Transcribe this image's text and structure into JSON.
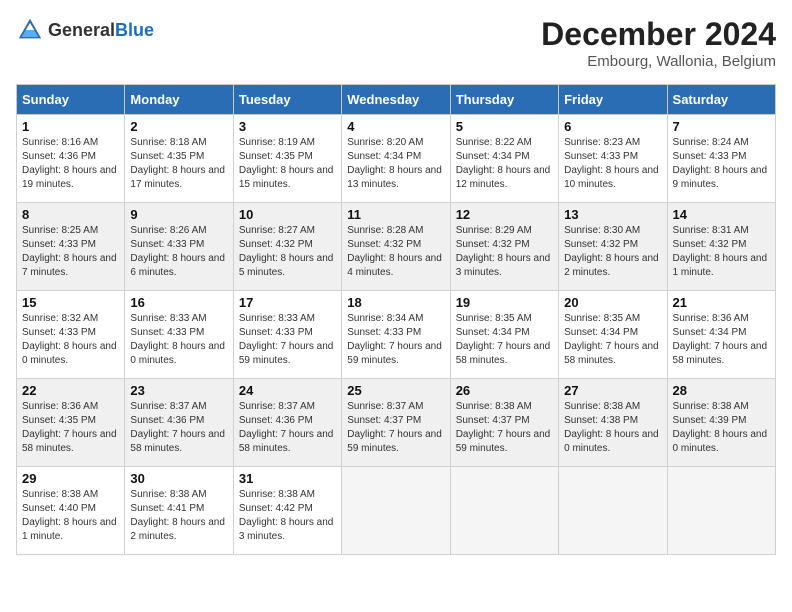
{
  "header": {
    "logo_general": "General",
    "logo_blue": "Blue",
    "month_year": "December 2024",
    "location": "Embourg, Wallonia, Belgium"
  },
  "days_of_week": [
    "Sunday",
    "Monday",
    "Tuesday",
    "Wednesday",
    "Thursday",
    "Friday",
    "Saturday"
  ],
  "weeks": [
    [
      {
        "day": "1",
        "sunrise": "8:16 AM",
        "sunset": "4:36 PM",
        "daylight": "8 hours and 19 minutes"
      },
      {
        "day": "2",
        "sunrise": "8:18 AM",
        "sunset": "4:35 PM",
        "daylight": "8 hours and 17 minutes"
      },
      {
        "day": "3",
        "sunrise": "8:19 AM",
        "sunset": "4:35 PM",
        "daylight": "8 hours and 15 minutes"
      },
      {
        "day": "4",
        "sunrise": "8:20 AM",
        "sunset": "4:34 PM",
        "daylight": "8 hours and 13 minutes"
      },
      {
        "day": "5",
        "sunrise": "8:22 AM",
        "sunset": "4:34 PM",
        "daylight": "8 hours and 12 minutes"
      },
      {
        "day": "6",
        "sunrise": "8:23 AM",
        "sunset": "4:33 PM",
        "daylight": "8 hours and 10 minutes"
      },
      {
        "day": "7",
        "sunrise": "8:24 AM",
        "sunset": "4:33 PM",
        "daylight": "8 hours and 9 minutes"
      }
    ],
    [
      {
        "day": "8",
        "sunrise": "8:25 AM",
        "sunset": "4:33 PM",
        "daylight": "8 hours and 7 minutes"
      },
      {
        "day": "9",
        "sunrise": "8:26 AM",
        "sunset": "4:33 PM",
        "daylight": "8 hours and 6 minutes"
      },
      {
        "day": "10",
        "sunrise": "8:27 AM",
        "sunset": "4:32 PM",
        "daylight": "8 hours and 5 minutes"
      },
      {
        "day": "11",
        "sunrise": "8:28 AM",
        "sunset": "4:32 PM",
        "daylight": "8 hours and 4 minutes"
      },
      {
        "day": "12",
        "sunrise": "8:29 AM",
        "sunset": "4:32 PM",
        "daylight": "8 hours and 3 minutes"
      },
      {
        "day": "13",
        "sunrise": "8:30 AM",
        "sunset": "4:32 PM",
        "daylight": "8 hours and 2 minutes"
      },
      {
        "day": "14",
        "sunrise": "8:31 AM",
        "sunset": "4:32 PM",
        "daylight": "8 hours and 1 minute"
      }
    ],
    [
      {
        "day": "15",
        "sunrise": "8:32 AM",
        "sunset": "4:33 PM",
        "daylight": "8 hours and 0 minutes"
      },
      {
        "day": "16",
        "sunrise": "8:33 AM",
        "sunset": "4:33 PM",
        "daylight": "8 hours and 0 minutes"
      },
      {
        "day": "17",
        "sunrise": "8:33 AM",
        "sunset": "4:33 PM",
        "daylight": "7 hours and 59 minutes"
      },
      {
        "day": "18",
        "sunrise": "8:34 AM",
        "sunset": "4:33 PM",
        "daylight": "7 hours and 59 minutes"
      },
      {
        "day": "19",
        "sunrise": "8:35 AM",
        "sunset": "4:34 PM",
        "daylight": "7 hours and 58 minutes"
      },
      {
        "day": "20",
        "sunrise": "8:35 AM",
        "sunset": "4:34 PM",
        "daylight": "7 hours and 58 minutes"
      },
      {
        "day": "21",
        "sunrise": "8:36 AM",
        "sunset": "4:34 PM",
        "daylight": "7 hours and 58 minutes"
      }
    ],
    [
      {
        "day": "22",
        "sunrise": "8:36 AM",
        "sunset": "4:35 PM",
        "daylight": "7 hours and 58 minutes"
      },
      {
        "day": "23",
        "sunrise": "8:37 AM",
        "sunset": "4:36 PM",
        "daylight": "7 hours and 58 minutes"
      },
      {
        "day": "24",
        "sunrise": "8:37 AM",
        "sunset": "4:36 PM",
        "daylight": "7 hours and 58 minutes"
      },
      {
        "day": "25",
        "sunrise": "8:37 AM",
        "sunset": "4:37 PM",
        "daylight": "7 hours and 59 minutes"
      },
      {
        "day": "26",
        "sunrise": "8:38 AM",
        "sunset": "4:37 PM",
        "daylight": "7 hours and 59 minutes"
      },
      {
        "day": "27",
        "sunrise": "8:38 AM",
        "sunset": "4:38 PM",
        "daylight": "8 hours and 0 minutes"
      },
      {
        "day": "28",
        "sunrise": "8:38 AM",
        "sunset": "4:39 PM",
        "daylight": "8 hours and 0 minutes"
      }
    ],
    [
      {
        "day": "29",
        "sunrise": "8:38 AM",
        "sunset": "4:40 PM",
        "daylight": "8 hours and 1 minute"
      },
      {
        "day": "30",
        "sunrise": "8:38 AM",
        "sunset": "4:41 PM",
        "daylight": "8 hours and 2 minutes"
      },
      {
        "day": "31",
        "sunrise": "8:38 AM",
        "sunset": "4:42 PM",
        "daylight": "8 hours and 3 minutes"
      },
      null,
      null,
      null,
      null
    ]
  ]
}
